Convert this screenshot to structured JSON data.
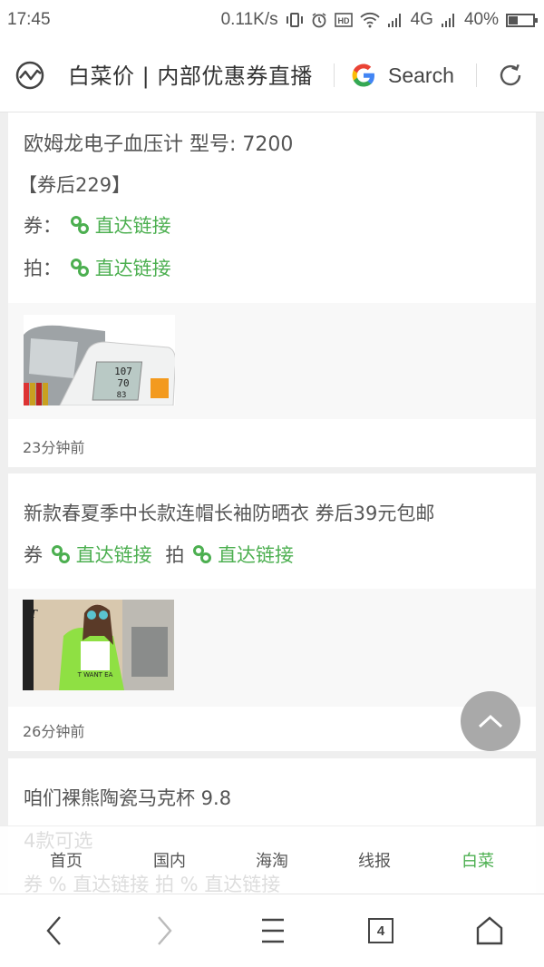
{
  "status_bar": {
    "time": "17:45",
    "net_speed": "0.11K/s",
    "network_type": "4G",
    "battery_percent_label": "40%",
    "battery_level": 0.4,
    "icons": [
      "vibrate-icon",
      "alarm-icon",
      "hd-icon",
      "wifi-icon",
      "signal-icon",
      "signal-icon-2",
      "battery-icon"
    ]
  },
  "browser": {
    "page_title": "白菜价 | 内部优惠券直播",
    "search_label": "Search",
    "open_tabs_count": "4"
  },
  "colors": {
    "accent_green": "#4caf50",
    "text": "#555555",
    "scroll_top_bg": "#a9a9a9"
  },
  "feed": {
    "items": [
      {
        "title": "欧姆龙电子血压计 型号: 7200",
        "subtitle": "【券后229】",
        "coupon_label": "券：",
        "coupon_link": "直达链接",
        "buy_label": "拍：",
        "buy_link": "直达链接",
        "image_alt": "欧姆龙电子血压计",
        "time": "23分钟前"
      },
      {
        "title": "新款春夏季中长款连帽长袖防晒衣  券后39元包邮",
        "coupon_label": "券",
        "coupon_link": "直达链接",
        "buy_label": "拍",
        "buy_link": "直达链接",
        "image_alt": "防晒衣",
        "image_caption": "T WANT EA",
        "time": "26分钟前"
      },
      {
        "title": "咱们裸熊陶瓷马克杯 9.8",
        "subtitle": "4款可选",
        "coupon_label": "券",
        "coupon_link": "直达链接",
        "buy_label": "拍",
        "buy_link": "直达链接"
      }
    ]
  },
  "tab_bar": {
    "tabs": [
      {
        "label": "首页",
        "active": false
      },
      {
        "label": "国内",
        "active": false
      },
      {
        "label": "海淘",
        "active": false
      },
      {
        "label": "线报",
        "active": false
      },
      {
        "label": "白菜",
        "active": true
      }
    ]
  }
}
